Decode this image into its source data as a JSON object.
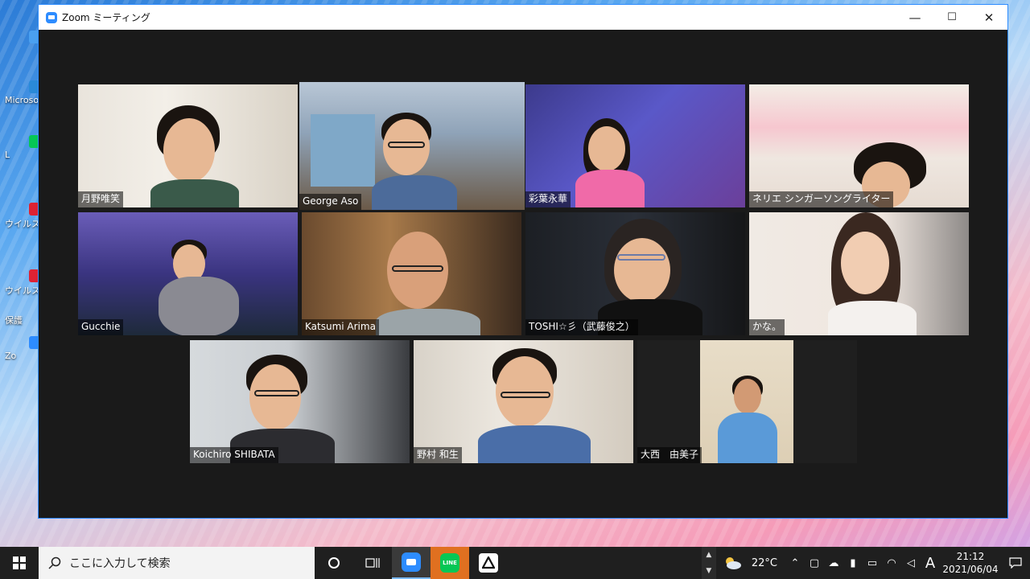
{
  "window": {
    "title": "Zoom ミーティング",
    "minimize": "—",
    "maximize": "☐",
    "close": "✕"
  },
  "desktop": {
    "icons": [
      "",
      "Microso",
      "L",
      "ウイルスバ",
      "ウイルスバ",
      "保護",
      "Zo",
      ""
    ]
  },
  "participants": [
    {
      "name": "月野唯笑",
      "active": false
    },
    {
      "name": "George Aso",
      "active": true
    },
    {
      "name": "彩葉永華",
      "active": false
    },
    {
      "name": "ネリエ シンガーソングライター",
      "active": false
    },
    {
      "name": "Gucchie",
      "active": false
    },
    {
      "name": "Katsumi Arima",
      "active": false
    },
    {
      "name": "TOSHI☆彡（武藤俊之）",
      "active": false
    },
    {
      "name": "かな。",
      "active": false
    },
    {
      "name": "Koichiro SHIBATA",
      "active": false
    },
    {
      "name": "野村 和生",
      "active": false
    },
    {
      "name": "大西　由美子",
      "active": false
    }
  ],
  "taskbar": {
    "search_placeholder": "ここに入力して検索",
    "weather": "22°C",
    "ime": "A",
    "time": "21:12",
    "date": "2021/06/04"
  },
  "colors": {
    "zoom_blue": "#2d8cff",
    "active_speaker": "#c7e057",
    "line_green": "#06c755"
  }
}
